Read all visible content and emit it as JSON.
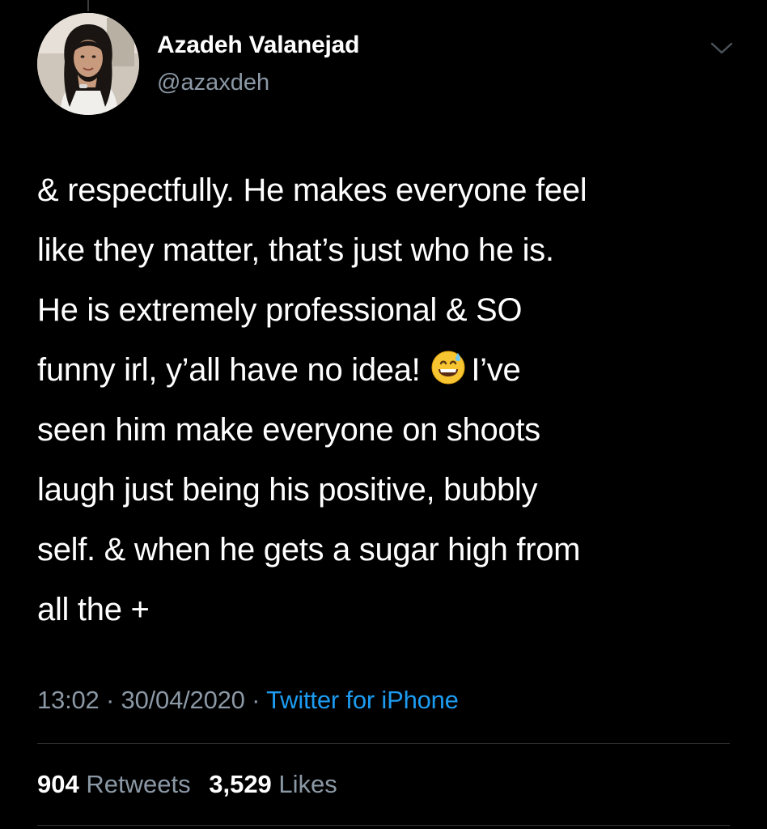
{
  "tweet": {
    "author": {
      "name": "Azadeh Valanejad",
      "handle": "@azaxdeh",
      "avatar_icon": "profile-photo"
    },
    "text_lines": [
      "& respectfully. He makes everyone feel",
      "like they matter, that’s just who he is.",
      "He is extremely professional & SO",
      "funny irl, y’all have no idea!",
      "I’ve",
      "seen him make everyone on shoots",
      "laugh just being his positive, bubbly",
      "self. & when he gets a sugar high from",
      "all the +"
    ],
    "emoji": "grinning-face-with-sweat-icon",
    "time": "13:02",
    "date": "30/04/2020",
    "separator": "·",
    "source": "Twitter for iPhone"
  },
  "stats": {
    "retweets_count": "904",
    "retweets_label": "Retweets",
    "likes_count": "3,529",
    "likes_label": "Likes"
  },
  "colors": {
    "background": "#000000",
    "text": "#ffffff",
    "secondary": "#8b98a5",
    "link": "#1d9bf0",
    "divider": "#2f3336"
  }
}
